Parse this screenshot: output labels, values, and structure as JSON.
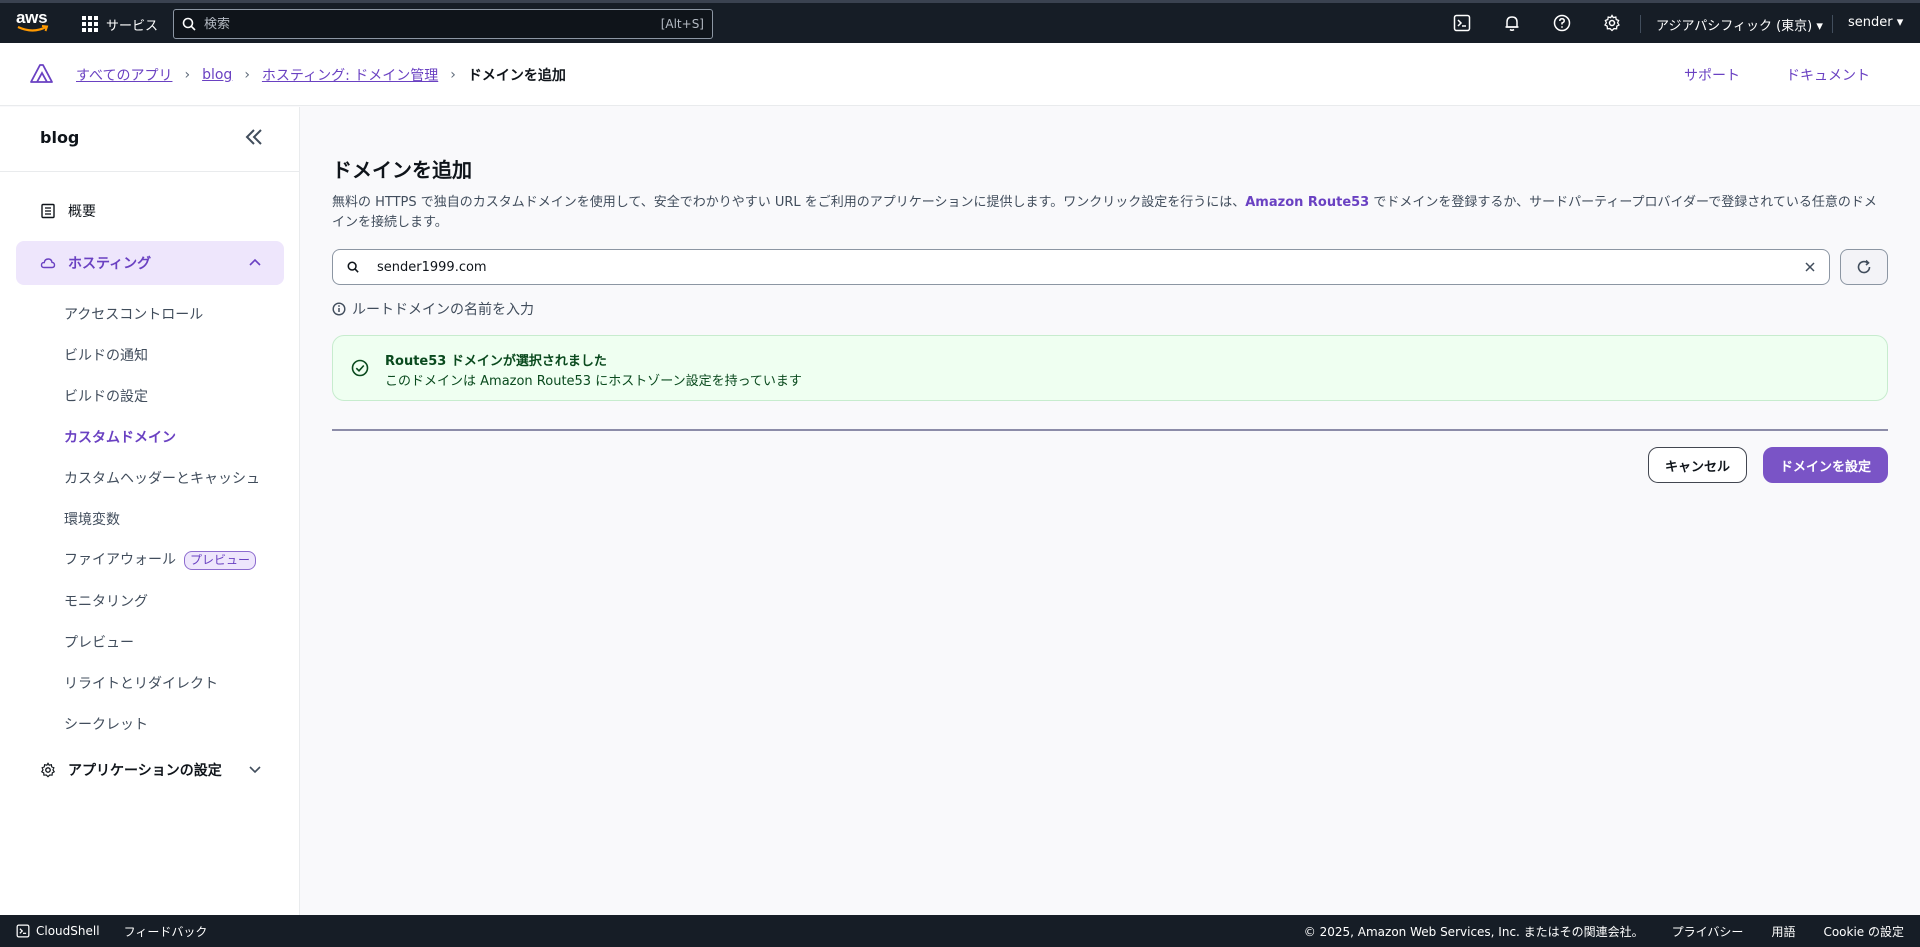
{
  "topnav": {
    "logo_text": "aws",
    "services_label": "サービス",
    "search_placeholder": "検索",
    "search_shortcut": "[Alt+S]",
    "region": "アジアパシフィック (東京) ▾",
    "user": "sender ▾"
  },
  "breadcrumb": {
    "items": [
      "すべてのアプリ",
      "blog",
      "ホスティング: ドメイン管理"
    ],
    "current": "ドメインを追加",
    "support": "サポート",
    "docs": "ドキュメント"
  },
  "sidebar": {
    "app_name": "blog",
    "overview": "概要",
    "hosting": "ホスティング",
    "sub_items": [
      "アクセスコントロール",
      "ビルドの通知",
      "ビルドの設定",
      "カスタムドメイン",
      "カスタムヘッダーとキャッシュ",
      "環境変数",
      "ファイアウォール",
      "モニタリング",
      "プレビュー",
      "リライトとリダイレクト",
      "シークレット"
    ],
    "preview_badge": "プレビュー",
    "app_settings": "アプリケーションの設定"
  },
  "main": {
    "title": "ドメインを追加",
    "desc_before": "無料の HTTPS で独自のカスタムドメインを使用して、安全でわかりやすい URL をご利用のアプリケーションに提供します。ワンクリック設定を行うには、",
    "desc_link": "Amazon Route53",
    "desc_after": " でドメインを登録するか、サードパーティープロバイダーで登録されている任意のドメインを接続します。",
    "domain_value": "sender1999.com",
    "hint": "ルートドメインの名前を入力",
    "alert_title": "Route53 ドメインが選択されました",
    "alert_msg": "このドメインは Amazon Route53 にホストゾーン設定を持っています",
    "cancel": "キャンセル",
    "submit": "ドメインを設定"
  },
  "footer": {
    "cloudshell": "CloudShell",
    "feedback": "フィードバック",
    "copyright": "© 2025, Amazon Web Services, Inc. またはその関連会社。",
    "privacy": "プライバシー",
    "terms": "用語",
    "cookie": "Cookie の設定"
  },
  "colors": {
    "accent": "#6a41c2",
    "primary_button": "#7a54c6",
    "topnav_bg": "#161d26",
    "success_bg": "#effff1"
  }
}
